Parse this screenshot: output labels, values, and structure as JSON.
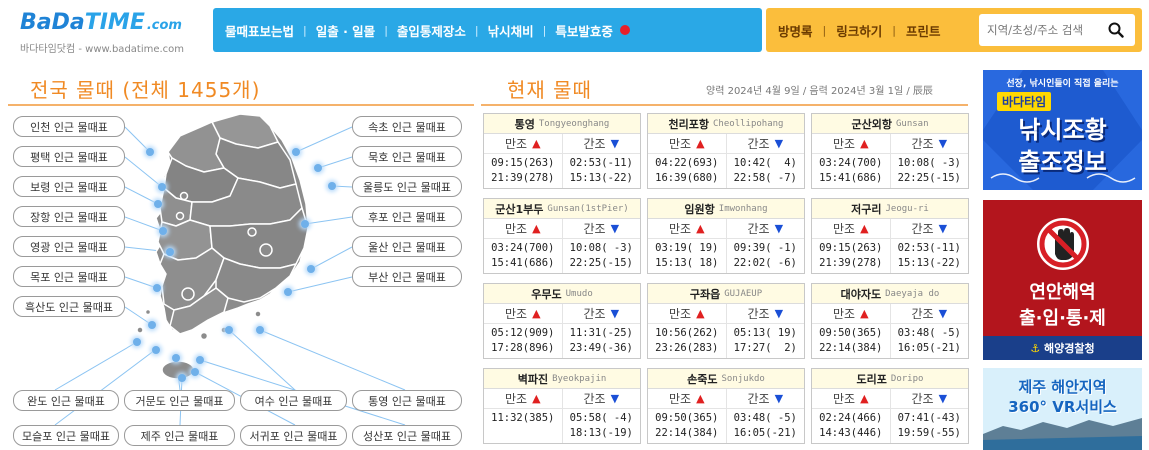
{
  "logo": {
    "brand_a": "BaDa",
    "brand_b": "TIME",
    "brand_c": ".com",
    "subtitle": "바다타임닷컴 - www.badatime.com"
  },
  "nav": {
    "items": [
      "물때표보는법",
      "일출 · 일몰",
      "출입통제장소",
      "낚시채비",
      "특보발효중"
    ]
  },
  "util": {
    "items": [
      "방명록",
      "링크하기",
      "프린트"
    ],
    "search_placeholder": "지역/초성/주소 검색"
  },
  "left": {
    "title": "전국 물때 (전체 1455개)",
    "left_buttons": [
      "인천 인근 물때표",
      "평택 인근 물때표",
      "보령 인근 물때표",
      "장항 인근 물때표",
      "영광 인근 물때표",
      "목포 인근 물때표",
      "흑산도 인근 물때표"
    ],
    "right_buttons": [
      "속초 인근 물때표",
      "묵호 인근 물때표",
      "울릉도 인근 물때표",
      "후포 인근 물때표",
      "울산 인근 물때표",
      "부산 인근 물때표"
    ],
    "bottom_row1": [
      "완도 인근 물때표",
      "거문도 인근 물때표",
      "여수 인근 물때표",
      "통영 인근 물때표"
    ],
    "bottom_row2": [
      "모슬포 인근 물때표",
      "제주 인근 물때표",
      "서귀포 인근 물때표",
      "성산포 인근 물때표"
    ]
  },
  "current": {
    "title": "현재 물때",
    "date_line": "양력 2024년 4월 9일 / 음력 2024년 3월 1일 / 辰辰",
    "high_label": "만조",
    "low_label": "간조",
    "cards": [
      {
        "name": "통영",
        "en": "Tongyeonghang",
        "high": "09:15(263)\n21:39(278)",
        "low": "02:53(-11)\n15:13(-22)"
      },
      {
        "name": "천리포항",
        "en": "Cheollipohang",
        "high": "04:22(693)\n16:39(680)",
        "low": "10:42(  4)\n22:58( -7)"
      },
      {
        "name": "군산외항",
        "en": "Gunsan",
        "high": "03:24(700)\n15:41(686)",
        "low": "10:08( -3)\n22:25(-15)"
      },
      {
        "name": "군산1부두",
        "en": "Gunsan(1stPier)",
        "high": "03:24(700)\n15:41(686)",
        "low": "10:08( -3)\n22:25(-15)"
      },
      {
        "name": "임원항",
        "en": "Imwonhang",
        "high": "03:19( 19)\n15:13( 18)",
        "low": "09:39( -1)\n22:02( -6)"
      },
      {
        "name": "저구리",
        "en": "Jeogu-ri",
        "high": "09:15(263)\n21:39(278)",
        "low": "02:53(-11)\n15:13(-22)"
      },
      {
        "name": "우무도",
        "en": "Umudo",
        "high": "05:12(909)\n17:28(896)",
        "low": "11:31(-25)\n23:49(-36)"
      },
      {
        "name": "구좌읍",
        "en": "GUJAEUP",
        "high": "10:56(262)\n23:26(283)",
        "low": "05:13( 19)\n17:27(  2)"
      },
      {
        "name": "대야자도",
        "en": "Daeyaja do",
        "high": "09:50(365)\n22:14(384)",
        "low": "03:48( -5)\n16:05(-21)"
      },
      {
        "name": "벽파진",
        "en": "Byeokpajin",
        "high": "11:32(385)",
        "low": "05:58( -4)\n18:13(-19)"
      },
      {
        "name": "손죽도",
        "en": "Sonjukdo",
        "high": "09:50(365)\n22:14(384)",
        "low": "03:48( -5)\n16:05(-21)"
      },
      {
        "name": "도리포",
        "en": "Doripo",
        "high": "02:24(466)\n14:43(446)",
        "low": "07:41(-43)\n19:59(-55)"
      }
    ]
  },
  "banners": {
    "b1": {
      "top": "선장, 낚시인들이 직접 올리는",
      "logo": "바다타임",
      "line1": "낚시조황",
      "line2": "출조정보"
    },
    "b2": {
      "line1": "연안해역",
      "line2": "출·입·통·제",
      "footer": "해양경찰청"
    },
    "b3": {
      "line1": "제주 해안지역",
      "line2": "360° VR서비스"
    }
  },
  "colors": {
    "nav_bg": "#2aa8e6",
    "util_bg": "#fbbe3c",
    "title_orange": "#f08a24",
    "high_red": "#e02020",
    "low_blue": "#1a4fd6"
  }
}
